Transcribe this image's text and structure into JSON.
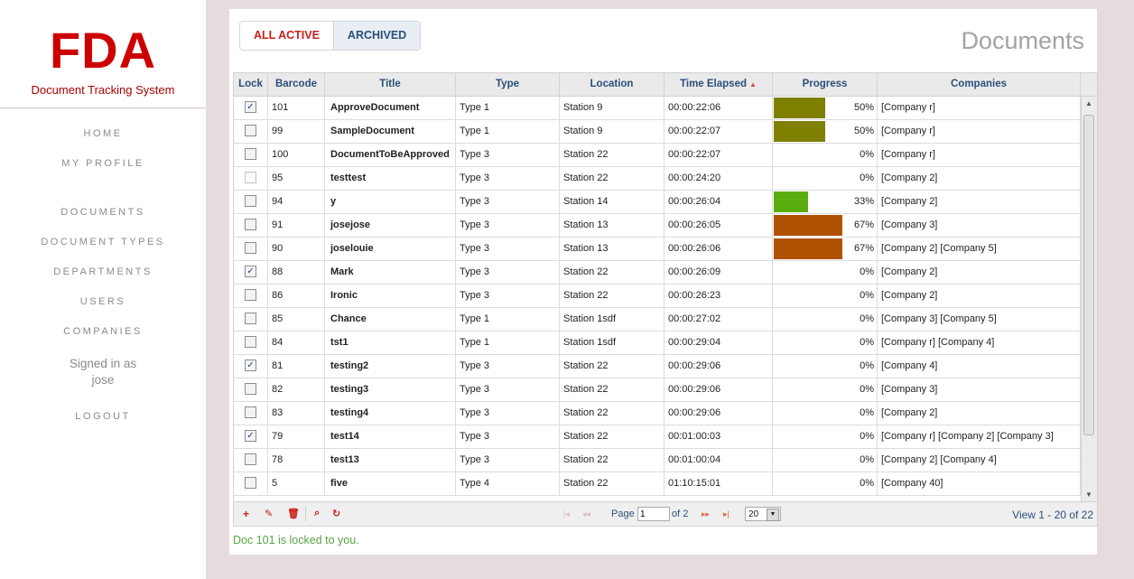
{
  "sidebar": {
    "logo": "FDA",
    "tagline": "Document Tracking System",
    "nav": [
      "HOME",
      "MY PROFILE",
      "DOCUMENTS",
      "DOCUMENT TYPES",
      "DEPARTMENTS",
      "USERS",
      "COMPANIES"
    ],
    "signed_in_line1": "Signed in as",
    "signed_in_line2": "jose",
    "logout": "LOGOUT"
  },
  "tabs": {
    "active": "ALL ACTIVE",
    "archived": "ARCHIVED"
  },
  "page_title": "Documents",
  "grid": {
    "columns": [
      "Lock",
      "Barcode",
      "Title",
      "Type",
      "Location",
      "Time Elapsed",
      "Progress",
      "Companies"
    ],
    "rows": [
      {
        "lock": true,
        "barcode": "101",
        "title": "ApproveDocument",
        "type": "Type 1",
        "location": "Station 9",
        "time": "00:00:22:06",
        "progress": 50,
        "progress_label": "50%",
        "companies": "[Company r]",
        "bar_color": "#7f7f00"
      },
      {
        "lock": false,
        "barcode": "99",
        "title": "SampleDocument",
        "type": "Type 1",
        "location": "Station 9",
        "time": "00:00:22:07",
        "progress": 50,
        "progress_label": "50%",
        "companies": "[Company r]",
        "bar_color": "#7f7f00"
      },
      {
        "lock": false,
        "barcode": "100",
        "title": "DocumentToBeApproved",
        "type": "Type 3",
        "location": "Station 22",
        "time": "00:00:22:07",
        "progress": 0,
        "progress_label": "0%",
        "companies": "[Company r]"
      },
      {
        "lock": false,
        "disabled": true,
        "barcode": "95",
        "title": "testtest",
        "type": "Type 3",
        "location": "Station 22",
        "time": "00:00:24:20",
        "progress": 0,
        "progress_label": "0%",
        "companies": "[Company 2]"
      },
      {
        "lock": false,
        "barcode": "94",
        "title": "y",
        "type": "Type 3",
        "location": "Station 14",
        "time": "00:00:26:04",
        "progress": 33,
        "progress_label": "33%",
        "companies": "[Company 2]",
        "bar_color": "#5aad0e"
      },
      {
        "lock": false,
        "barcode": "91",
        "title": "josejose",
        "type": "Type 3",
        "location": "Station 13",
        "time": "00:00:26:05",
        "progress": 67,
        "progress_label": "67%",
        "companies": "[Company 3]",
        "bar_color": "#b05200"
      },
      {
        "lock": false,
        "barcode": "90",
        "title": "joselouie",
        "type": "Type 3",
        "location": "Station 13",
        "time": "00:00:26:06",
        "progress": 67,
        "progress_label": "67%",
        "companies": "[Company 2] [Company 5]",
        "bar_color": "#b05200"
      },
      {
        "lock": true,
        "barcode": "88",
        "title": "Mark",
        "type": "Type 3",
        "location": "Station 22",
        "time": "00:00:26:09",
        "progress": 0,
        "progress_label": "0%",
        "companies": "[Company 2]"
      },
      {
        "lock": false,
        "barcode": "86",
        "title": "Ironic",
        "type": "Type 3",
        "location": "Station 22",
        "time": "00:00:26:23",
        "progress": 0,
        "progress_label": "0%",
        "companies": "[Company 2]"
      },
      {
        "lock": false,
        "barcode": "85",
        "title": "Chance",
        "type": "Type 1",
        "location": "Station 1sdf",
        "time": "00:00:27:02",
        "progress": 0,
        "progress_label": "0%",
        "companies": "[Company 3] [Company 5]"
      },
      {
        "lock": false,
        "barcode": "84",
        "title": "tst1",
        "type": "Type 1",
        "location": "Station 1sdf",
        "time": "00:00:29:04",
        "progress": 0,
        "progress_label": "0%",
        "companies": "[Company r] [Company 4]"
      },
      {
        "lock": true,
        "barcode": "81",
        "title": "testing2",
        "type": "Type 3",
        "location": "Station 22",
        "time": "00:00:29:06",
        "progress": 0,
        "progress_label": "0%",
        "companies": "[Company 4]"
      },
      {
        "lock": false,
        "barcode": "82",
        "title": "testing3",
        "type": "Type 3",
        "location": "Station 22",
        "time": "00:00:29:06",
        "progress": 0,
        "progress_label": "0%",
        "companies": "[Company 3]"
      },
      {
        "lock": false,
        "barcode": "83",
        "title": "testing4",
        "type": "Type 3",
        "location": "Station 22",
        "time": "00:00:29:06",
        "progress": 0,
        "progress_label": "0%",
        "companies": "[Company 2]"
      },
      {
        "lock": true,
        "barcode": "79",
        "title": "test14",
        "type": "Type 3",
        "location": "Station 22",
        "time": "00:01:00:03",
        "progress": 0,
        "progress_label": "0%",
        "companies": "[Company r] [Company 2] [Company 3]"
      },
      {
        "lock": false,
        "barcode": "78",
        "title": "test13",
        "type": "Type 3",
        "location": "Station 22",
        "time": "00:01:00:04",
        "progress": 0,
        "progress_label": "0%",
        "companies": "[Company 2] [Company 4]"
      },
      {
        "lock": false,
        "barcode": "5",
        "title": "five",
        "type": "Type 4",
        "location": "Station 22",
        "time": "01:10:15:01",
        "progress": 0,
        "progress_label": "0%",
        "companies": "[Company 40]"
      }
    ]
  },
  "pager": {
    "page_label": "Page",
    "page_value": "1",
    "of_label": "of 2",
    "page_size": "20",
    "view_text": "View 1 - 20 of 22"
  },
  "message": "Doc 101 is locked to you."
}
